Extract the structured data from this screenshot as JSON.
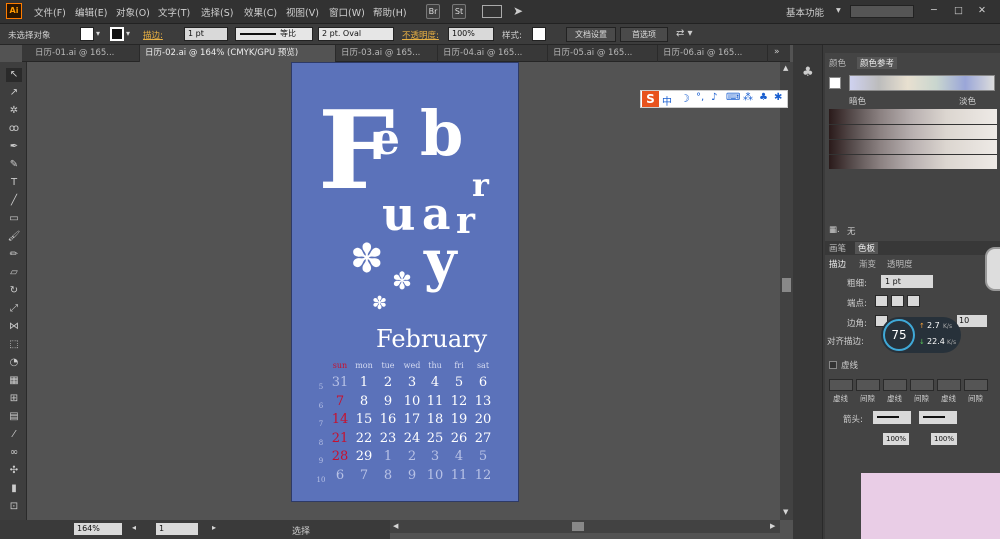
{
  "menubar": {
    "items": [
      "文件(F)",
      "编辑(E)",
      "对象(O)",
      "文字(T)",
      "选择(S)",
      "效果(C)",
      "视图(V)",
      "窗口(W)",
      "帮助(H)"
    ],
    "br": "Br",
    "st": "St",
    "workspace": "基本功能",
    "window_controls": [
      "─",
      "□",
      "✕"
    ]
  },
  "controlbar": {
    "selection": "未选择对象",
    "stroke_label": "描边:",
    "stroke_weight": "1 pt",
    "stroke_profile": "等比",
    "brush": "2 pt. Oval",
    "opacity_label": "不透明度:",
    "opacity": "100%",
    "style_label": "样式:",
    "doc_setup": "文档设置",
    "prefs": "首选项"
  },
  "tabs": [
    {
      "label": "日历-01.ai @ 165..."
    },
    {
      "label": "日历-02.ai @ 164% (CMYK/GPU 预览)"
    },
    {
      "label": "日历-03.ai @ 165..."
    },
    {
      "label": "日历-04.ai @ 165..."
    },
    {
      "label": "日历-05.ai @ 165..."
    },
    {
      "label": "日历-06.ai @ 165..."
    }
  ],
  "artboard": {
    "color": "#5b72ba",
    "month_title": "February",
    "weekdays": [
      "sun",
      "mon",
      "tue",
      "wed",
      "thu",
      "fri",
      "sat"
    ],
    "week_numbers": [
      "5",
      "6",
      "7",
      "8",
      "9",
      "10"
    ],
    "weeks": [
      [
        "31",
        "1",
        "2",
        "3",
        "4",
        "5",
        "6"
      ],
      [
        "7",
        "8",
        "9",
        "10",
        "11",
        "12",
        "13"
      ],
      [
        "14",
        "15",
        "16",
        "17",
        "18",
        "19",
        "20"
      ],
      [
        "21",
        "22",
        "23",
        "24",
        "25",
        "26",
        "27"
      ],
      [
        "28",
        "29",
        "1",
        "2",
        "3",
        "4",
        "5"
      ],
      [
        "6",
        "7",
        "8",
        "9",
        "10",
        "11",
        "12"
      ]
    ],
    "dim": [
      [
        1,
        0,
        0,
        0,
        0,
        0,
        0
      ],
      [
        0,
        0,
        0,
        0,
        0,
        0,
        0
      ],
      [
        0,
        0,
        0,
        0,
        0,
        0,
        0
      ],
      [
        0,
        0,
        0,
        0,
        0,
        0,
        0
      ],
      [
        0,
        0,
        1,
        1,
        1,
        1,
        1
      ],
      [
        1,
        1,
        1,
        1,
        1,
        1,
        1
      ]
    ],
    "sunday_color": "#c8102e"
  },
  "ime_toolbar": {
    "items": [
      "S",
      "中",
      "☽",
      "°,",
      "🎤",
      "⌨",
      "👕",
      "🔧"
    ]
  },
  "right_panel": {
    "tab_swatch": "颜色",
    "tab_guide": "颜色参考",
    "dark_label": "暗色",
    "light_label": "淡色",
    "none_label": "无",
    "tab_brush": "画笔",
    "tab_color": "色板",
    "stroke_tab": "描边",
    "grad_tab": "渐变",
    "transp_tab": "透明度",
    "weight_label": "粗细:",
    "weight_value": "1 pt",
    "cap_label": "端点:",
    "corner_label": "边角:",
    "limit_value": "10",
    "align_label": "对齐描边:",
    "dashed_label": "虚线",
    "dash_labels": [
      "虚线",
      "间隙",
      "虚线",
      "间隙",
      "虚线",
      "间隙"
    ],
    "arrow_label": "箭头:",
    "scale_value1": "100%",
    "scale_value2": "100%",
    "net_percent": "75",
    "up_speed": "2.7",
    "down_speed": "22.4",
    "speed_unit": "K/s"
  },
  "status": {
    "zoom": "164%",
    "page": "1",
    "tool": "选择"
  }
}
